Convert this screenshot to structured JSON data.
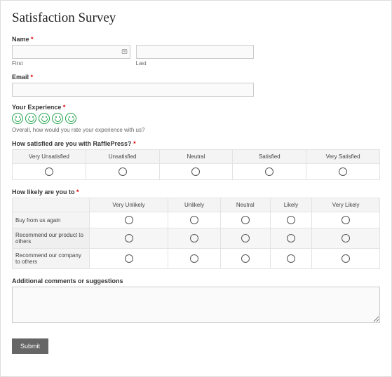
{
  "title": "Satisfaction Survey",
  "fields": {
    "name": {
      "label": "Name",
      "first_sublabel": "First",
      "last_sublabel": "Last"
    },
    "email": {
      "label": "Email"
    },
    "experience": {
      "label": "Your Experience",
      "helper": "Overall, how would you rate your experience with us?"
    },
    "satisfaction": {
      "label": "How satisfied are you with RafflePress?",
      "columns": [
        "Very Unsatisfied",
        "Unsatisfied",
        "Neutral",
        "Satisfied",
        "Very Satisfied"
      ]
    },
    "likelihood": {
      "label": "How likely are you to",
      "columns": [
        "Very Unlikely",
        "Unlikely",
        "Neutral",
        "Likely",
        "Very Likely"
      ],
      "rows": [
        "Buy from us again",
        "Recommend our product to others",
        "Recommend our company to others"
      ]
    },
    "comments": {
      "label": "Additional comments or suggestions"
    }
  },
  "required_marker": "*",
  "submit_label": "Submit"
}
